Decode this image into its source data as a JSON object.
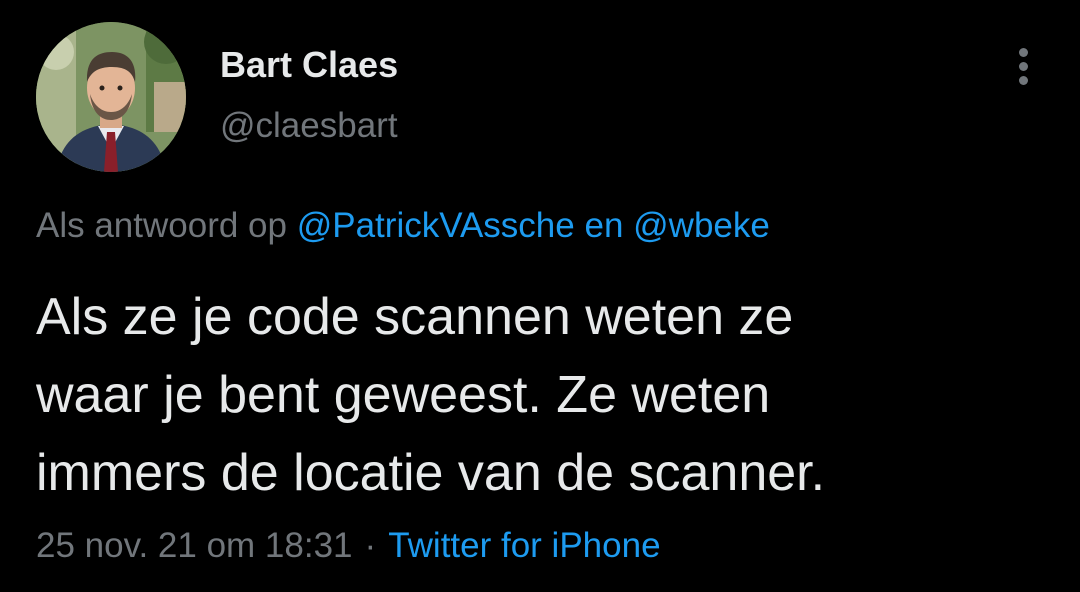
{
  "author": {
    "display_name": "Bart Claes",
    "handle": "@claesbart",
    "avatar_icon": "profile-photo"
  },
  "reply": {
    "prefix": "Als antwoord op",
    "mention_1": "@PatrickVAssche",
    "conjunction": "en",
    "mention_2": "@wbeke"
  },
  "tweet": {
    "lines": [
      "Als ze je code scannen weten ze",
      "waar je bent geweest. Ze weten",
      "immers de locatie van de scanner."
    ]
  },
  "meta": {
    "timestamp": "25 nov. 21 om 18:31",
    "separator": "·",
    "source": "Twitter for iPhone"
  },
  "colors": {
    "background": "#000000",
    "text": "#e7e9ea",
    "secondary": "#71767b",
    "link": "#1d9bf0"
  },
  "icons": {
    "more": "more-vertical-icon"
  }
}
